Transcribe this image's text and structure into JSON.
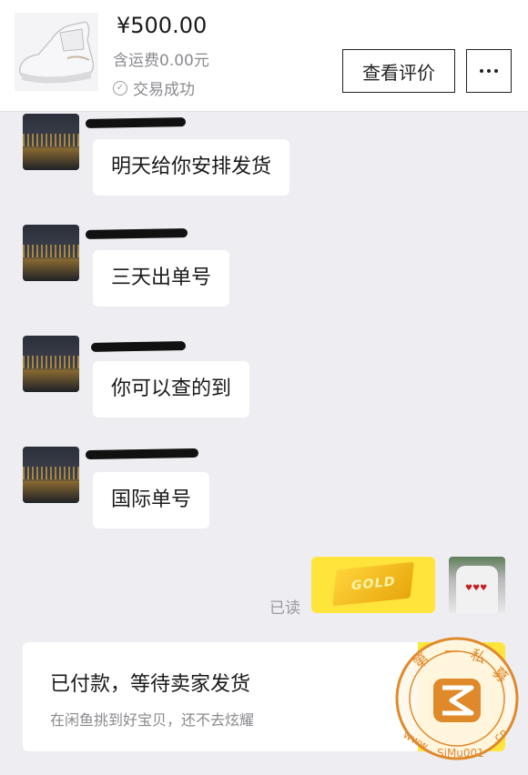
{
  "header": {
    "price": "¥500.00",
    "shipping": "含运费0.00元",
    "status": "交易成功",
    "review_button": "查看评价"
  },
  "messages": [
    {
      "text": "明天给你安排发货"
    },
    {
      "text": "三天出单号"
    },
    {
      "text": "你可以查的到"
    },
    {
      "text": "国际单号"
    }
  ],
  "self_message": {
    "read_status": "已读",
    "sticker_text": "GOLD"
  },
  "notice": {
    "title": "已付款，等待卖家发货",
    "subtitle": "在闲鱼挑到好宝贝，还不去炫耀"
  },
  "watermark": {
    "chars": [
      "第",
      "一",
      "私",
      "募"
    ],
    "url": "www.SiMu001.cn"
  },
  "colors": {
    "background": "#EDEDF2",
    "accent_yellow": "#FFE43B",
    "watermark_orange": "#E0892A"
  }
}
